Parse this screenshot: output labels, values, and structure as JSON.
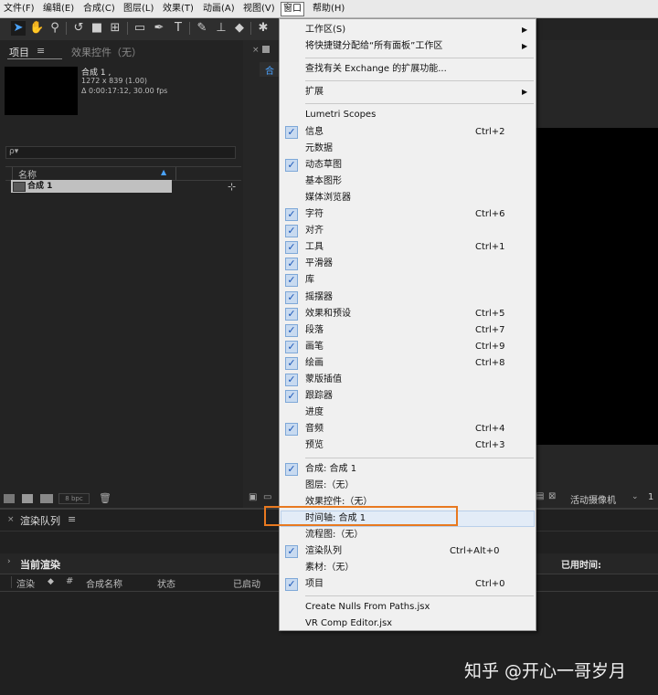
{
  "menubar": {
    "items": [
      "文件(F)",
      "编辑(E)",
      "合成(C)",
      "图层(L)",
      "效果(T)",
      "动画(A)",
      "视图(V)",
      "窗口",
      "帮助(H)"
    ]
  },
  "project": {
    "tab_project": "项目",
    "tab_effects": "效果控件（无）",
    "comp_name": "合成 1 ,",
    "comp_size": "1272 x 839 (1.00)",
    "comp_duration": "Δ 0:00:17:12, 30.00 fps",
    "search_placeholder": "ρ▾",
    "col_name": "名称",
    "item_name": "合成 1",
    "bpc": "8 bpc"
  },
  "viewer": {
    "comp_tab": "合",
    "camera": "活动摄像机",
    "one": "1"
  },
  "render_queue": {
    "tab": "渲染队列",
    "current_render": "当前渲染",
    "elapsed": "已用时间:",
    "cols": [
      "渲染",
      "#",
      "合成名称",
      "状态",
      "已启动"
    ]
  },
  "window_menu": {
    "items": [
      {
        "label": "工作区(S)",
        "sub": true
      },
      {
        "label": "将快捷键分配给“所有面板”工作区",
        "sub": true
      },
      {
        "sep": true
      },
      {
        "label": "查找有关 Exchange 的扩展功能..."
      },
      {
        "sep": true
      },
      {
        "label": "扩展",
        "sub": true
      },
      {
        "sep": true
      },
      {
        "label": "Lumetri Scopes"
      },
      {
        "label": "信息",
        "checked": true,
        "shortcut": "Ctrl+2"
      },
      {
        "label": "元数据"
      },
      {
        "label": "动态草图",
        "checked": true
      },
      {
        "label": "基本图形"
      },
      {
        "label": "媒体浏览器"
      },
      {
        "label": "字符",
        "checked": true,
        "shortcut": "Ctrl+6"
      },
      {
        "label": "对齐",
        "checked": true
      },
      {
        "label": "工具",
        "checked": true,
        "shortcut": "Ctrl+1"
      },
      {
        "label": "平滑器",
        "checked": true
      },
      {
        "label": "库",
        "checked": true
      },
      {
        "label": "摇摆器",
        "checked": true
      },
      {
        "label": "效果和预设",
        "checked": true,
        "shortcut": "Ctrl+5"
      },
      {
        "label": "段落",
        "checked": true,
        "shortcut": "Ctrl+7"
      },
      {
        "label": "画笔",
        "checked": true,
        "shortcut": "Ctrl+9"
      },
      {
        "label": "绘画",
        "checked": true,
        "shortcut": "Ctrl+8"
      },
      {
        "label": "蒙版插值",
        "checked": true
      },
      {
        "label": "跟踪器",
        "checked": true
      },
      {
        "label": "进度"
      },
      {
        "label": "音频",
        "checked": true,
        "shortcut": "Ctrl+4"
      },
      {
        "label": "预览",
        "shortcut": "Ctrl+3"
      },
      {
        "sep": true
      },
      {
        "label": "合成: 合成 1",
        "checked": true
      },
      {
        "label": "图层:（无）"
      },
      {
        "label": "效果控件:（无）"
      },
      {
        "label": "时间轴: 合成 1",
        "highlighted": true
      },
      {
        "label": "流程图:（无）"
      },
      {
        "label": "渲染队列",
        "checked": true,
        "shortcut": "Ctrl+Alt+0"
      },
      {
        "label": "素材:（无）"
      },
      {
        "label": "项目",
        "checked": true,
        "shortcut": "Ctrl+0"
      },
      {
        "sep": true
      },
      {
        "label": "Create Nulls From Paths.jsx"
      },
      {
        "label": "VR Comp Editor.jsx"
      }
    ]
  },
  "watermark": "知乎 @开心一哥岁月"
}
